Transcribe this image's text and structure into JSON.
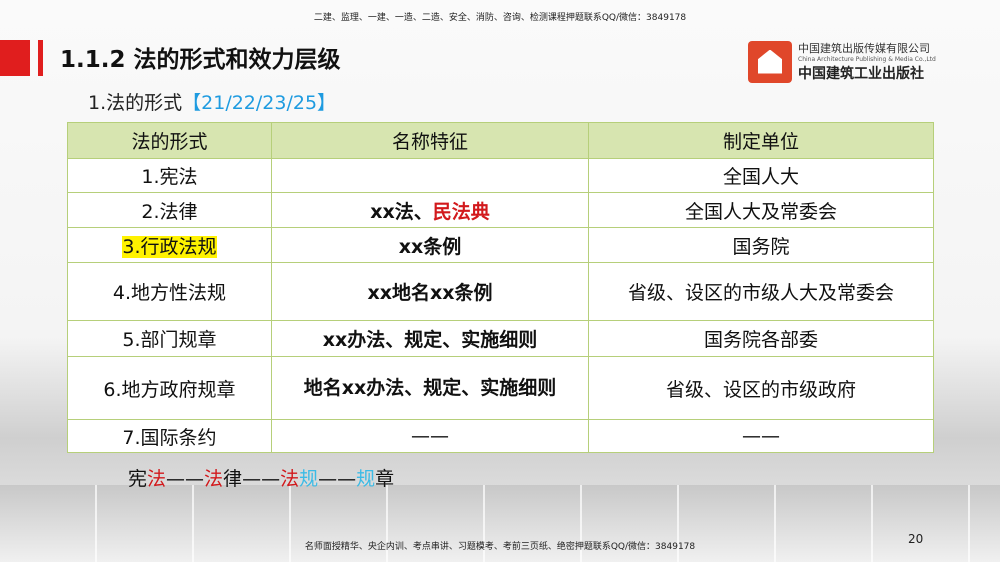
{
  "header_notice": "二建、监理、一建、一造、二造、安全、消防、咨询、检测课程押题联系QQ/微信：3849178",
  "footer_notice": "名师面授精华、央企内训、考点串讲、习题模考、考前三页纸、绝密押题联系QQ/微信：3849178",
  "title": "1.1.2  法的形式和效力层级",
  "subtitle": {
    "text": "1.法的形式",
    "years": "【21/22/23/25】"
  },
  "logo": {
    "cn": "中国建筑出版传媒有限公司",
    "en": "China Architecture Publishing & Media Co.,Ltd",
    "brand": "中国建筑工业出版社"
  },
  "table": {
    "headers": [
      "法的形式",
      "名称特征",
      "制定单位"
    ],
    "rows": [
      {
        "form": "1.宪法",
        "feature_a": "",
        "feature_b": "",
        "maker": "全国人大"
      },
      {
        "form": "2.法律",
        "feature_a": "xx法、",
        "feature_b": "民法典",
        "maker": "全国人大及常委会"
      },
      {
        "form": "3.行政法规",
        "feature_a": "xx条例",
        "feature_b": "",
        "maker": "国务院"
      },
      {
        "form": "4.地方性法规",
        "feature_a": "xx地名xx条例",
        "feature_b": "",
        "maker": "省级、设区的市级人大及常委会"
      },
      {
        "form": "5.部门规章",
        "feature_a": "xx办法、规定、实施细则",
        "feature_b": "",
        "maker": "国务院各部委"
      },
      {
        "form": "6.地方政府规章",
        "feature_a": "地名xx办法、规定、实施细则",
        "feature_b": "",
        "maker": "省级、设区的市级政府"
      },
      {
        "form": "7.国际条约",
        "feature_a": "——",
        "feature_b": "",
        "maker": "——"
      }
    ]
  },
  "chain": [
    "宪",
    "法",
    "——",
    "法",
    "律",
    "——",
    "法",
    "规",
    "——",
    "规",
    "章"
  ],
  "page_number": "20",
  "colors": {
    "accent_red": "#e01e1e",
    "blue": "#1e9be0",
    "header_green": "#d7e5b0",
    "highlight": "#fff200"
  }
}
